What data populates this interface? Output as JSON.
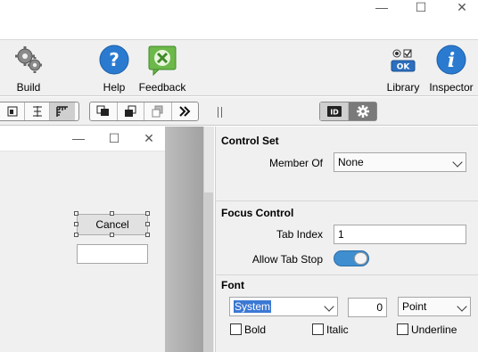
{
  "window_controls": {
    "minimize": "—",
    "maximize": "☐",
    "close": "✕"
  },
  "toolbar": {
    "build": "Build",
    "help": "Help",
    "feedback": "Feedback",
    "library": "Library",
    "inspector": "Inspector"
  },
  "child_window": {
    "minimize": "—",
    "maximize": "☐",
    "close": "✕"
  },
  "canvas": {
    "cancel_button": "Cancel",
    "text_field": ""
  },
  "inspector": {
    "control_set": {
      "title": "Control Set",
      "member_of_label": "Member Of",
      "member_of_value": "None"
    },
    "focus_control": {
      "title": "Focus Control",
      "tab_index_label": "Tab Index",
      "tab_index_value": "1",
      "allow_tab_stop_label": "Allow Tab Stop",
      "allow_tab_stop": true
    },
    "font": {
      "title": "Font",
      "family": "System",
      "size": "0",
      "unit": "Point",
      "bold_label": "Bold",
      "italic_label": "Italic",
      "underline_label": "Underline"
    }
  },
  "colors": {
    "toggle": "#3e8ed0",
    "help_icon": "#2a7bd0",
    "feedback_icon": "#5aa83a",
    "selection": "#3b78d4"
  }
}
